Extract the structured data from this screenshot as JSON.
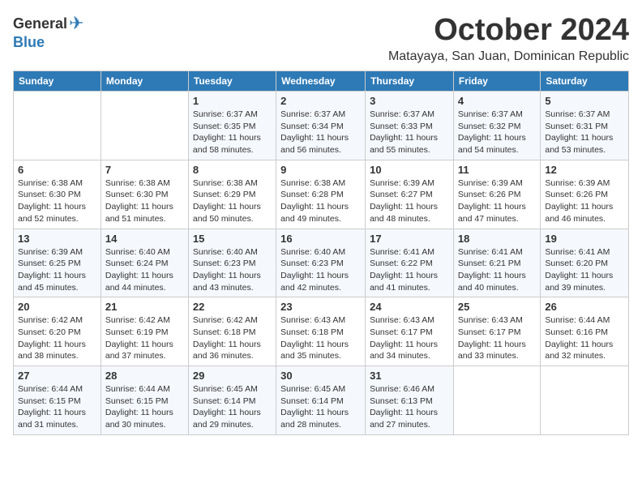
{
  "logo": {
    "general": "General",
    "blue": "Blue"
  },
  "header": {
    "month": "October 2024",
    "location": "Matayaya, San Juan, Dominican Republic"
  },
  "weekdays": [
    "Sunday",
    "Monday",
    "Tuesday",
    "Wednesday",
    "Thursday",
    "Friday",
    "Saturday"
  ],
  "weeks": [
    [
      {
        "day": "",
        "detail": ""
      },
      {
        "day": "",
        "detail": ""
      },
      {
        "day": "1",
        "detail": "Sunrise: 6:37 AM\nSunset: 6:35 PM\nDaylight: 11 hours\nand 58 minutes."
      },
      {
        "day": "2",
        "detail": "Sunrise: 6:37 AM\nSunset: 6:34 PM\nDaylight: 11 hours\nand 56 minutes."
      },
      {
        "day": "3",
        "detail": "Sunrise: 6:37 AM\nSunset: 6:33 PM\nDaylight: 11 hours\nand 55 minutes."
      },
      {
        "day": "4",
        "detail": "Sunrise: 6:37 AM\nSunset: 6:32 PM\nDaylight: 11 hours\nand 54 minutes."
      },
      {
        "day": "5",
        "detail": "Sunrise: 6:37 AM\nSunset: 6:31 PM\nDaylight: 11 hours\nand 53 minutes."
      }
    ],
    [
      {
        "day": "6",
        "detail": "Sunrise: 6:38 AM\nSunset: 6:30 PM\nDaylight: 11 hours\nand 52 minutes."
      },
      {
        "day": "7",
        "detail": "Sunrise: 6:38 AM\nSunset: 6:30 PM\nDaylight: 11 hours\nand 51 minutes."
      },
      {
        "day": "8",
        "detail": "Sunrise: 6:38 AM\nSunset: 6:29 PM\nDaylight: 11 hours\nand 50 minutes."
      },
      {
        "day": "9",
        "detail": "Sunrise: 6:38 AM\nSunset: 6:28 PM\nDaylight: 11 hours\nand 49 minutes."
      },
      {
        "day": "10",
        "detail": "Sunrise: 6:39 AM\nSunset: 6:27 PM\nDaylight: 11 hours\nand 48 minutes."
      },
      {
        "day": "11",
        "detail": "Sunrise: 6:39 AM\nSunset: 6:26 PM\nDaylight: 11 hours\nand 47 minutes."
      },
      {
        "day": "12",
        "detail": "Sunrise: 6:39 AM\nSunset: 6:26 PM\nDaylight: 11 hours\nand 46 minutes."
      }
    ],
    [
      {
        "day": "13",
        "detail": "Sunrise: 6:39 AM\nSunset: 6:25 PM\nDaylight: 11 hours\nand 45 minutes."
      },
      {
        "day": "14",
        "detail": "Sunrise: 6:40 AM\nSunset: 6:24 PM\nDaylight: 11 hours\nand 44 minutes."
      },
      {
        "day": "15",
        "detail": "Sunrise: 6:40 AM\nSunset: 6:23 PM\nDaylight: 11 hours\nand 43 minutes."
      },
      {
        "day": "16",
        "detail": "Sunrise: 6:40 AM\nSunset: 6:23 PM\nDaylight: 11 hours\nand 42 minutes."
      },
      {
        "day": "17",
        "detail": "Sunrise: 6:41 AM\nSunset: 6:22 PM\nDaylight: 11 hours\nand 41 minutes."
      },
      {
        "day": "18",
        "detail": "Sunrise: 6:41 AM\nSunset: 6:21 PM\nDaylight: 11 hours\nand 40 minutes."
      },
      {
        "day": "19",
        "detail": "Sunrise: 6:41 AM\nSunset: 6:20 PM\nDaylight: 11 hours\nand 39 minutes."
      }
    ],
    [
      {
        "day": "20",
        "detail": "Sunrise: 6:42 AM\nSunset: 6:20 PM\nDaylight: 11 hours\nand 38 minutes."
      },
      {
        "day": "21",
        "detail": "Sunrise: 6:42 AM\nSunset: 6:19 PM\nDaylight: 11 hours\nand 37 minutes."
      },
      {
        "day": "22",
        "detail": "Sunrise: 6:42 AM\nSunset: 6:18 PM\nDaylight: 11 hours\nand 36 minutes."
      },
      {
        "day": "23",
        "detail": "Sunrise: 6:43 AM\nSunset: 6:18 PM\nDaylight: 11 hours\nand 35 minutes."
      },
      {
        "day": "24",
        "detail": "Sunrise: 6:43 AM\nSunset: 6:17 PM\nDaylight: 11 hours\nand 34 minutes."
      },
      {
        "day": "25",
        "detail": "Sunrise: 6:43 AM\nSunset: 6:17 PM\nDaylight: 11 hours\nand 33 minutes."
      },
      {
        "day": "26",
        "detail": "Sunrise: 6:44 AM\nSunset: 6:16 PM\nDaylight: 11 hours\nand 32 minutes."
      }
    ],
    [
      {
        "day": "27",
        "detail": "Sunrise: 6:44 AM\nSunset: 6:15 PM\nDaylight: 11 hours\nand 31 minutes."
      },
      {
        "day": "28",
        "detail": "Sunrise: 6:44 AM\nSunset: 6:15 PM\nDaylight: 11 hours\nand 30 minutes."
      },
      {
        "day": "29",
        "detail": "Sunrise: 6:45 AM\nSunset: 6:14 PM\nDaylight: 11 hours\nand 29 minutes."
      },
      {
        "day": "30",
        "detail": "Sunrise: 6:45 AM\nSunset: 6:14 PM\nDaylight: 11 hours\nand 28 minutes."
      },
      {
        "day": "31",
        "detail": "Sunrise: 6:46 AM\nSunset: 6:13 PM\nDaylight: 11 hours\nand 27 minutes."
      },
      {
        "day": "",
        "detail": ""
      },
      {
        "day": "",
        "detail": ""
      }
    ]
  ]
}
